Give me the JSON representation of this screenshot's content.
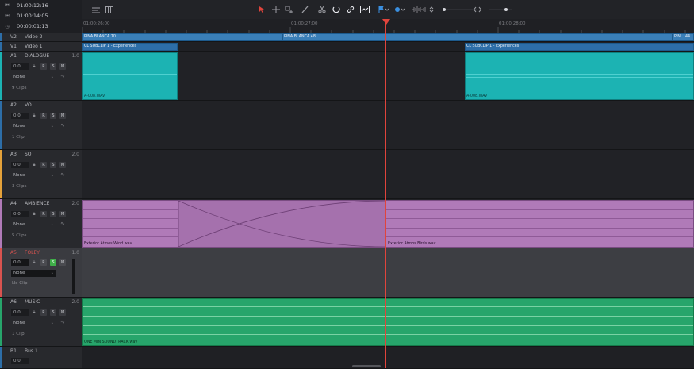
{
  "timecodes": {
    "current": "01:00:12:16",
    "end": "01:00:14:05",
    "duration": "00:00:01:13"
  },
  "icons": {
    "tc_in": "skip-start-icon",
    "tc_out": "skip-end-icon",
    "tc_dur": "clock-icon"
  },
  "ruler": {
    "labels": [
      "01:00:26:00",
      "01:00:27:00",
      "01:00:28:00"
    ]
  },
  "tracks": {
    "v2": {
      "id": "V2",
      "name": "Video 2"
    },
    "v1": {
      "id": "V1",
      "name": "Video 1"
    },
    "a1": {
      "id": "A1",
      "name": "DIALOGUE",
      "num": "1.0",
      "vol": "0.0",
      "sel": "None",
      "clips": "9 Clips"
    },
    "a2": {
      "id": "A2",
      "name": "VO",
      "num": "",
      "vol": "0.0",
      "sel": "None",
      "clips": "1 Clip"
    },
    "a3": {
      "id": "A3",
      "name": "SOT",
      "num": "2.0",
      "vol": "0.0",
      "sel": "None",
      "clips": "3 Clips"
    },
    "a4": {
      "id": "A4",
      "name": "AMBIENCE",
      "num": "2.0",
      "vol": "0.0",
      "sel": "None",
      "clips": "5 Clips"
    },
    "a5": {
      "id": "A5",
      "name": "FOLEY",
      "num": "1.0",
      "vol": "0.0",
      "sel": "None",
      "clips": "No Clip"
    },
    "a6": {
      "id": "A6",
      "name": "MUSIC",
      "num": "2.0",
      "vol": "0.0",
      "sel": "None",
      "clips": "1 Clip"
    },
    "b1": {
      "id": "B1",
      "name": "Bus 1",
      "num": "",
      "vol": "0.0"
    }
  },
  "buttons": {
    "r": "R",
    "s": "S",
    "m": "M"
  },
  "clips": {
    "v2a": "PINA BLANCA 70",
    "v2b": "PINA BLANCA 48",
    "v2c": "PIN... 44",
    "v1a": "CL SUBCLIP 1 - Experiences",
    "v1b": "CL SUBCLIP 1 - Experiences",
    "a1a": "A-008.WAV",
    "a1b": "A-008.WAV",
    "a4a": "Exterior Atmos Wind.wav",
    "a4b": "Exterior Atmos Birds.wav",
    "a6a": "ONE MIN SOUNDTRACK.wav"
  },
  "colors": {
    "video": "#3a7fb8",
    "dialogue": "#1cb3b3",
    "ambience": "#b07ab8",
    "music": "#27a56b",
    "playhead": "#e0443c",
    "foley_label": "#d9534f"
  }
}
